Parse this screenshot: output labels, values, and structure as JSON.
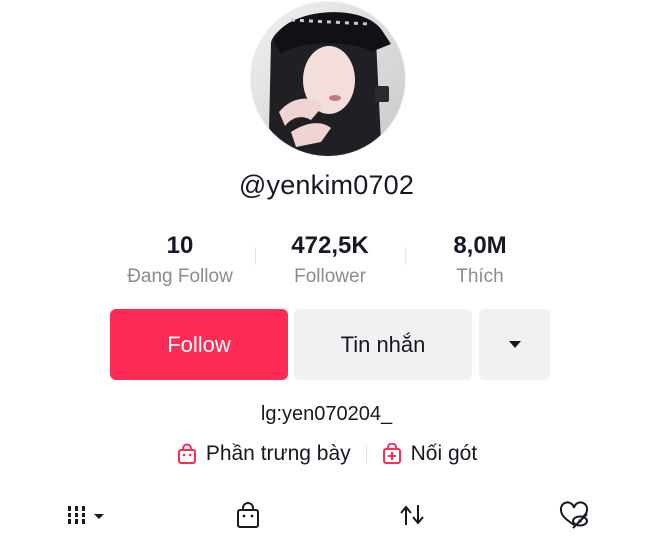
{
  "profile": {
    "username": "@yenkim0702",
    "bio": "lg:yen070204_"
  },
  "stats": [
    {
      "value": "10",
      "label": "Đang Follow"
    },
    {
      "value": "472,5K",
      "label": "Follower"
    },
    {
      "value": "8,0M",
      "label": "Thích"
    }
  ],
  "actions": {
    "follow_label": "Follow",
    "message_label": "Tin nhắn",
    "more_icon": "caret-down-icon"
  },
  "links": [
    {
      "label": "Phần trưng bày",
      "icon": "shopping-bag-icon"
    },
    {
      "label": "Nối gót",
      "icon": "add-box-icon"
    }
  ],
  "tabs": [
    {
      "icon": "videos-grid-icon"
    },
    {
      "icon": "shop-bag-icon"
    },
    {
      "icon": "repost-icon"
    },
    {
      "icon": "liked-hidden-icon"
    }
  ],
  "colors": {
    "accent": "#fe2c55",
    "text": "#161823",
    "muted": "#8a8b91",
    "button_bg": "#f1f1f2"
  }
}
